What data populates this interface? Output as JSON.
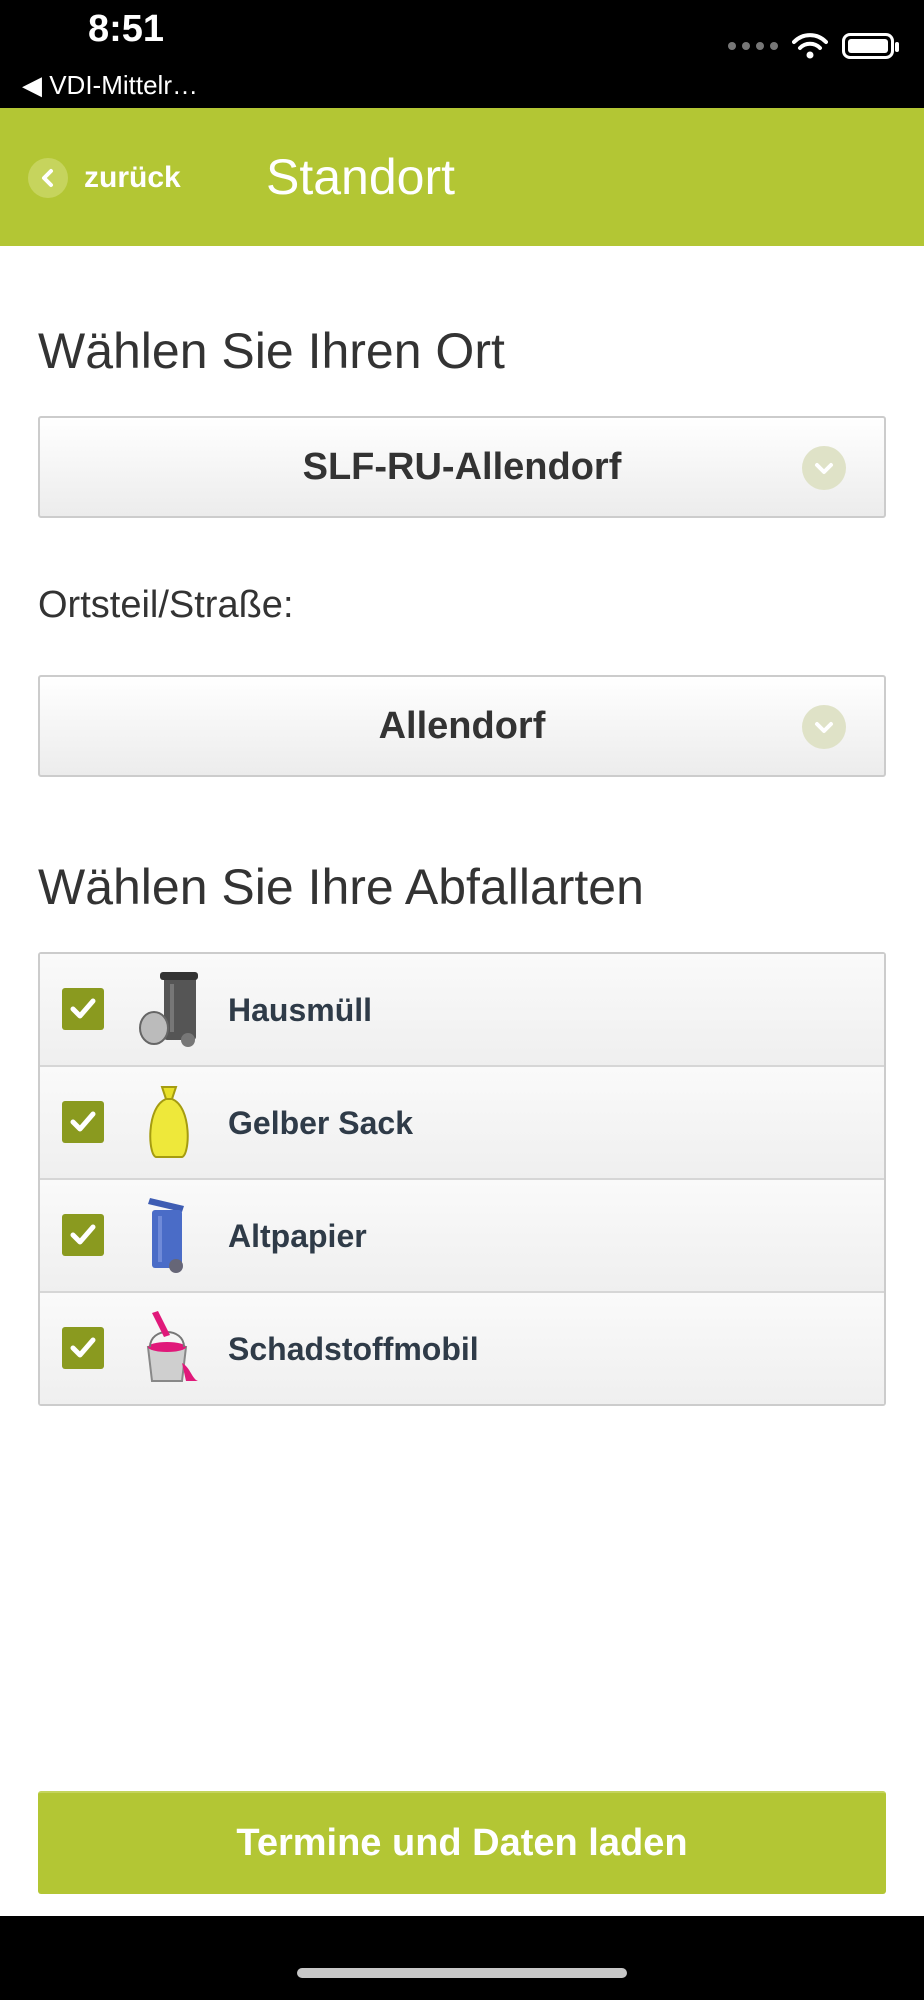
{
  "status_bar": {
    "time": "8:51",
    "back_app": "◀ VDI-Mittelr…"
  },
  "header": {
    "back_label": "zurück",
    "title": "Standort"
  },
  "location": {
    "heading": "Wählen Sie Ihren Ort",
    "selected": "SLF-RU-Allendorf"
  },
  "district": {
    "label": "Ortsteil/Straße:",
    "selected": "Allendorf"
  },
  "waste": {
    "heading": "Wählen Sie Ihre Abfallarten",
    "items": [
      {
        "label": "Hausmüll",
        "checked": true,
        "icon": "trash-bin-icon"
      },
      {
        "label": "Gelber Sack",
        "checked": true,
        "icon": "yellow-bag-icon"
      },
      {
        "label": "Altpapier",
        "checked": true,
        "icon": "paper-bin-icon"
      },
      {
        "label": "Schadstoffmobil",
        "checked": true,
        "icon": "paint-bucket-icon"
      }
    ]
  },
  "actions": {
    "load_label": "Termine und Daten laden"
  },
  "colors": {
    "accent": "#b3c634",
    "checkbox": "#8a9a1f"
  }
}
